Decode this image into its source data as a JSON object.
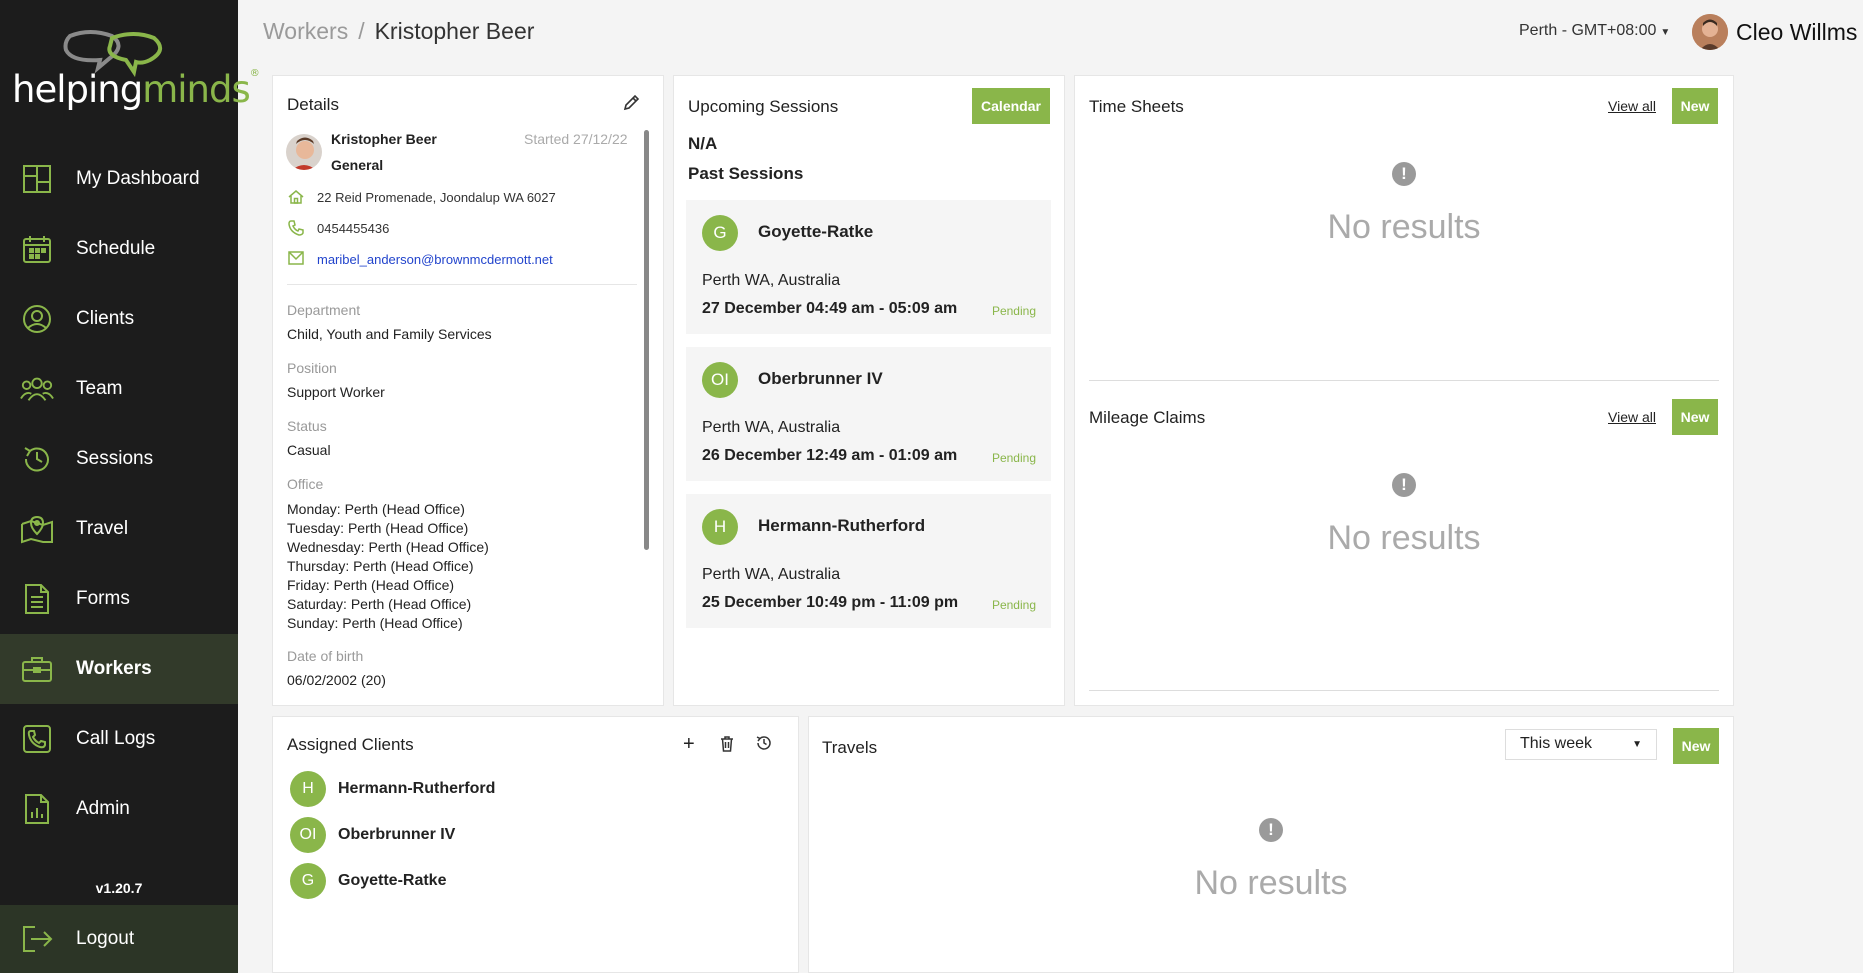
{
  "brand": {
    "part1": "helping",
    "part2": "minds",
    "reg": "®"
  },
  "sidebar": {
    "items": [
      {
        "label": "My Dashboard",
        "icon": "dashboard-icon"
      },
      {
        "label": "Schedule",
        "icon": "calendar-icon"
      },
      {
        "label": "Clients",
        "icon": "user-circle-icon"
      },
      {
        "label": "Team",
        "icon": "team-icon"
      },
      {
        "label": "Sessions",
        "icon": "history-icon"
      },
      {
        "label": "Travel",
        "icon": "map-pin-icon"
      },
      {
        "label": "Forms",
        "icon": "document-icon"
      },
      {
        "label": "Workers",
        "icon": "briefcase-icon",
        "active": true
      },
      {
        "label": "Call Logs",
        "icon": "phone-icon"
      },
      {
        "label": "Admin",
        "icon": "report-icon"
      }
    ],
    "version": "v1.20.7",
    "logout": "Logout"
  },
  "header": {
    "crumb_parent": "Workers",
    "crumb_sep": "/",
    "crumb_current": "Kristopher Beer",
    "timezone": "Perth - GMT+08:00",
    "user_name": "Cleo Willms"
  },
  "details": {
    "title": "Details",
    "name": "Kristopher Beer",
    "started": "Started 27/12/22",
    "type": "General",
    "address": "22 Reid Promenade, Joondalup WA 6027",
    "phone": "0454455436",
    "email": "maribel_anderson@brownmcdermott.net",
    "department_label": "Department",
    "department": "Child, Youth and Family Services",
    "position_label": "Position",
    "position": "Support Worker",
    "status_label": "Status",
    "status": "Casual",
    "office_label": "Office",
    "office": [
      "Monday: Perth (Head Office)",
      "Tuesday: Perth (Head Office)",
      "Wednesday: Perth (Head Office)",
      "Thursday: Perth (Head Office)",
      "Friday: Perth (Head Office)",
      "Saturday: Perth (Head Office)",
      "Sunday: Perth (Head Office)"
    ],
    "dob_label": "Date of birth",
    "dob": "06/02/2002 (20)"
  },
  "sessions": {
    "title": "Upcoming Sessions",
    "calendar_btn": "Calendar",
    "upcoming": "N/A",
    "past_title": "Past Sessions",
    "items": [
      {
        "initials": "G",
        "name": "Goyette-Ratke",
        "location": "Perth WA, Australia",
        "time": "27 December 04:49 am - 05:09 am",
        "status": "Pending"
      },
      {
        "initials": "OI",
        "name": "Oberbrunner IV",
        "location": "Perth WA, Australia",
        "time": "26 December 12:49 am - 01:09 am",
        "status": "Pending"
      },
      {
        "initials": "H",
        "name": "Hermann-Rutherford",
        "location": "Perth WA, Australia",
        "time": "25 December 10:49 pm - 11:09 pm",
        "status": "Pending"
      }
    ]
  },
  "timesheets": {
    "title": "Time Sheets",
    "view_all": "View all",
    "new": "New",
    "empty": "No results"
  },
  "mileage": {
    "title": "Mileage Claims",
    "view_all": "View all",
    "new": "New",
    "empty": "No results"
  },
  "assigned": {
    "title": "Assigned Clients",
    "items": [
      {
        "initials": "H",
        "name": "Hermann-Rutherford"
      },
      {
        "initials": "OI",
        "name": "Oberbrunner IV"
      },
      {
        "initials": "G",
        "name": "Goyette-Ratke"
      }
    ]
  },
  "travels": {
    "title": "Travels",
    "range": "This week",
    "new": "New",
    "empty": "No results"
  },
  "colors": {
    "accent": "#8ab64a",
    "sidebar": "#1c1c1c",
    "sidebar_active": "#323a2a"
  }
}
